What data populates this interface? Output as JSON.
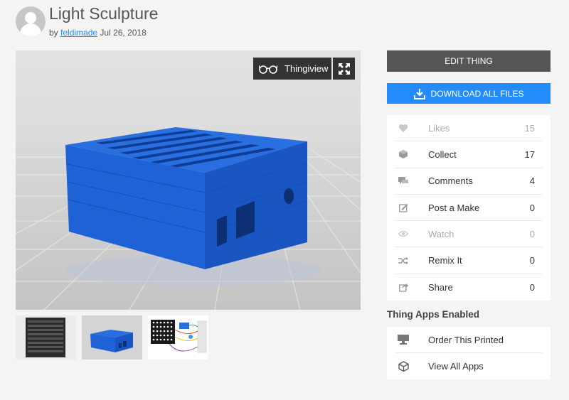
{
  "thing": {
    "title": "Light Sculpture",
    "by_prefix": "by",
    "author": "feldimade",
    "date": "Jul 26, 2018"
  },
  "viewer": {
    "thingiview_label": "Thingiview",
    "model_color": "#1f6fe6"
  },
  "thumbnails": [
    {
      "name": "led-matrix-photo"
    },
    {
      "name": "blue-case-render"
    },
    {
      "name": "wiring-diagram"
    }
  ],
  "actions": {
    "edit_label": "EDIT THING",
    "download_label": "DOWNLOAD ALL FILES"
  },
  "stats": [
    {
      "icon": "heart-icon",
      "label": "Likes",
      "value": "15",
      "muted": true
    },
    {
      "icon": "collect-icon",
      "label": "Collect",
      "value": "17",
      "muted": false
    },
    {
      "icon": "comments-icon",
      "label": "Comments",
      "value": "4",
      "muted": false
    },
    {
      "icon": "post-make-icon",
      "label": "Post a Make",
      "value": "0",
      "muted": false
    },
    {
      "icon": "eye-icon",
      "label": "Watch",
      "value": "0",
      "muted": true
    },
    {
      "icon": "remix-icon",
      "label": "Remix It",
      "value": "0",
      "muted": false
    },
    {
      "icon": "share-icon",
      "label": "Share",
      "value": "0",
      "muted": false
    }
  ],
  "apps": {
    "heading": "Thing Apps Enabled",
    "items": [
      {
        "icon": "printer-icon",
        "label": "Order This Printed"
      },
      {
        "icon": "cube-icon",
        "label": "View All Apps"
      }
    ]
  },
  "colors": {
    "accent": "#248bfb",
    "edit_button": "#555555"
  }
}
